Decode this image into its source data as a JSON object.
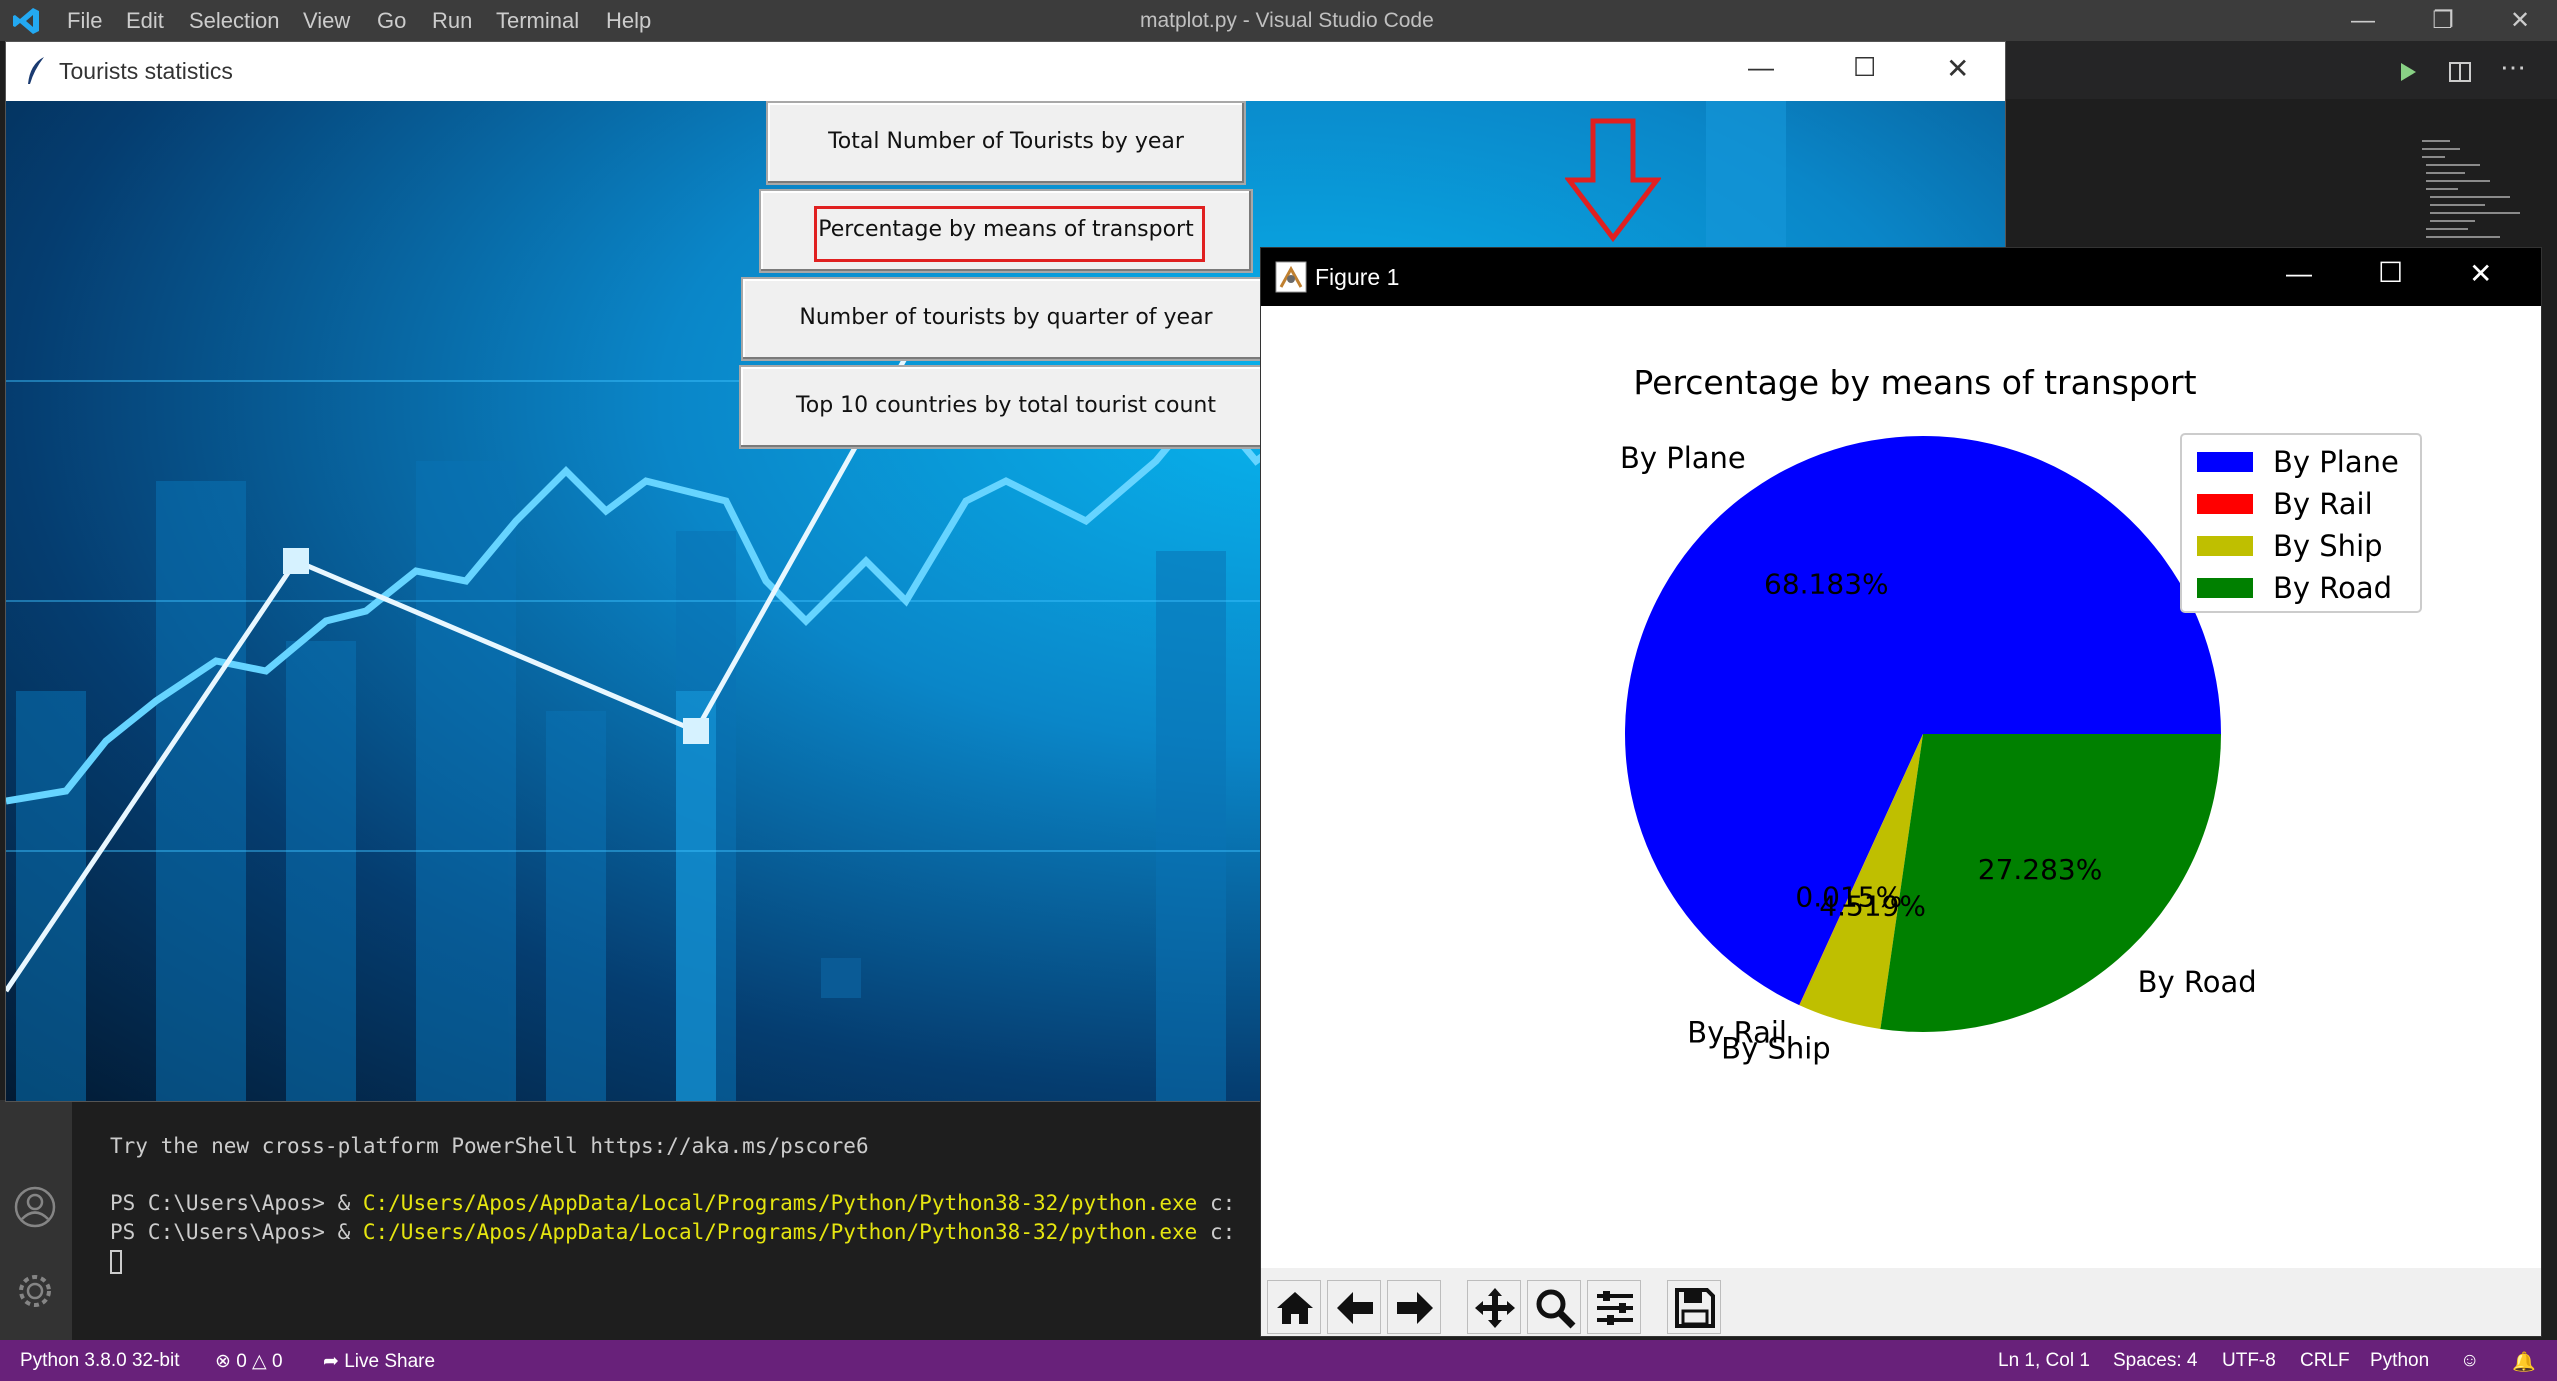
{
  "vscode": {
    "menu": [
      "File",
      "Edit",
      "Selection",
      "View",
      "Go",
      "Run",
      "Terminal",
      "Help"
    ],
    "title": "matplot.py - Visual Studio Code"
  },
  "tk_window": {
    "title": "Tourists statistics",
    "buttons": [
      "Total Number of Tourists by year",
      "Percentage by means of transport",
      "Number of tourists by quarter of year",
      "Top 10 countries by total tourist count"
    ]
  },
  "terminal": {
    "line1": "Try the new cross-platform PowerShell https://aka.ms/pscore6",
    "prompt": "PS C:\\Users\\Apos> & ",
    "path": "C:/Users/Apos/AppData/Local/Programs/Python/Python38-32/python.exe",
    "suffix": " c:"
  },
  "statusbar": {
    "python": "Python 3.8.0 32-bit",
    "problems": "0",
    "warnings": "0",
    "liveshare": "Live Share",
    "position": "Ln 1, Col 1",
    "spaces": "Spaces: 4",
    "encoding": "UTF-8",
    "eol": "CRLF",
    "language": "Python"
  },
  "figure": {
    "window_title": "Figure 1",
    "toolbar_icons": [
      "home-icon",
      "back-arrow-icon",
      "forward-arrow-icon",
      "pan-icon",
      "zoom-icon",
      "configure-icon",
      "save-icon"
    ]
  },
  "chart_data": {
    "type": "pie",
    "title": "Percentage by means of transport",
    "series": [
      {
        "name": "By Plane",
        "value": 68.183,
        "color": "#0000ff"
      },
      {
        "name": "By Rail",
        "value": 0.015,
        "color": "#ff0000"
      },
      {
        "name": "By Ship",
        "value": 4.519,
        "color": "#bfbf00"
      },
      {
        "name": "By Road",
        "value": 27.283,
        "color": "#008000"
      }
    ],
    "autopct_labels": [
      "68.183%",
      "0.015%",
      "4.519%",
      "27.283%"
    ],
    "legend": "top-right",
    "start_angle_deg": 0
  },
  "colors": {
    "statusbar": "#68217a",
    "highlight": "#e02020"
  }
}
